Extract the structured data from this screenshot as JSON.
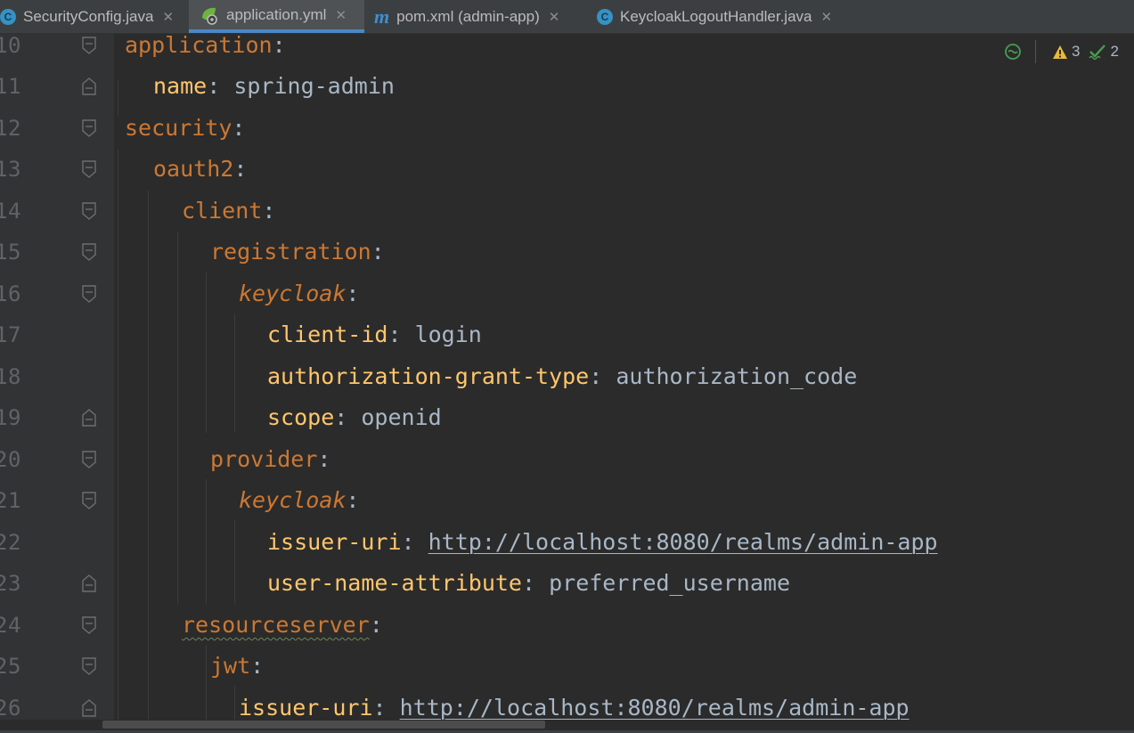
{
  "tabs": [
    {
      "label": "SecurityConfig.java",
      "icon": "class-c-icon",
      "close": "✕",
      "active": false
    },
    {
      "label": "application.yml",
      "icon": "spring-yml-icon",
      "close": "✕",
      "active": true
    },
    {
      "label": "pom.xml (admin-app)",
      "icon": "maven-m-icon",
      "close": "✕",
      "active": false
    },
    {
      "label": "KeycloakLogoutHandler.java",
      "icon": "class-c-icon",
      "close": "✕",
      "active": false
    }
  ],
  "icon_glyphs": {
    "class": "C",
    "maven": "m"
  },
  "inspections": {
    "warnings": "3",
    "weak_warnings": "2"
  },
  "lines": [
    {
      "num": "10",
      "key": "application",
      "sep": ":",
      "value": ""
    },
    {
      "num": "11",
      "key": "name",
      "sep": ": ",
      "value": "spring-admin"
    },
    {
      "num": "12",
      "key": "security",
      "sep": ":",
      "value": ""
    },
    {
      "num": "13",
      "key": "oauth2",
      "sep": ":",
      "value": ""
    },
    {
      "num": "14",
      "key": "client",
      "sep": ":",
      "value": ""
    },
    {
      "num": "15",
      "key": "registration",
      "sep": ":",
      "value": ""
    },
    {
      "num": "16",
      "key": "keycloak",
      "sep": ":",
      "value": ""
    },
    {
      "num": "17",
      "key": "client-id",
      "sep": ": ",
      "value": "login"
    },
    {
      "num": "18",
      "key": "authorization-grant-type",
      "sep": ": ",
      "value": "authorization_code"
    },
    {
      "num": "19",
      "key": "scope",
      "sep": ": ",
      "value": "openid"
    },
    {
      "num": "20",
      "key": "provider",
      "sep": ":",
      "value": ""
    },
    {
      "num": "21",
      "key": "keycloak",
      "sep": ":",
      "value": ""
    },
    {
      "num": "22",
      "key": "issuer-uri",
      "sep": ": ",
      "value": "http://localhost:8080/realms/admin-app"
    },
    {
      "num": "23",
      "key": "user-name-attribute",
      "sep": ": ",
      "value": "preferred_username"
    },
    {
      "num": "24",
      "key": "resourceserver",
      "sep": ":",
      "value": ""
    },
    {
      "num": "25",
      "key": "jwt",
      "sep": ":",
      "value": ""
    },
    {
      "num": "26",
      "key": "issuer-uri",
      "sep": ": ",
      "value": "http://localhost:8080/realms/admin-app"
    }
  ],
  "colors": {
    "editor_bg": "#2b2b2b",
    "gutter_bg": "#313335",
    "key_orange": "#cc7832",
    "key_yellow": "#ffc66d",
    "value_text": "#a9b7c6",
    "line_number": "#606366",
    "active_tab_underline": "#4a88c7",
    "warning_yellow": "#e8b93a",
    "weak_warning_green": "#499c54"
  }
}
